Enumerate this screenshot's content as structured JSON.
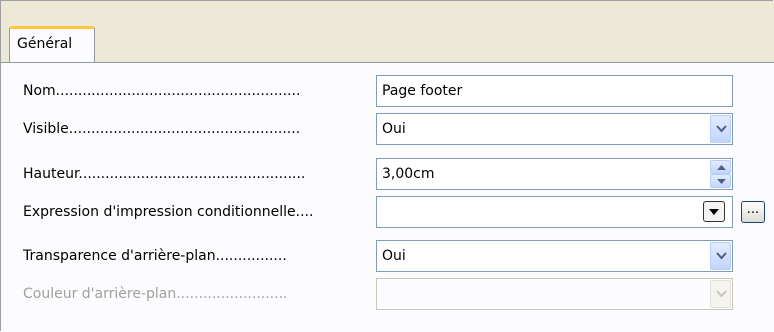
{
  "tabs": [
    {
      "label": "Général",
      "active": true
    }
  ],
  "properties": {
    "name": {
      "label": "Nom.......................................................",
      "value": "Page footer"
    },
    "visible": {
      "label": "Visible....................................................",
      "value": "Oui"
    },
    "height": {
      "label": "Hauteur...................................................",
      "value": "3,00cm"
    },
    "conditional_print": {
      "label": "Expression d'impression conditionnelle....",
      "value": "",
      "ellipsis_label": "..."
    },
    "bg_transparency": {
      "label": "Transparence d'arrière-plan................",
      "value": "Oui"
    },
    "bg_color": {
      "label": "Couleur d'arrière-plan.........................",
      "value": "",
      "disabled": true
    }
  },
  "colors": {
    "active_tab_accent": "#ffc83c",
    "field_border": "#7f9db9",
    "disabled_text": "#a0a0a0"
  },
  "icons": {
    "dropdown": "chevron-down-icon",
    "spinner": "spin-up-down-icon",
    "ellipsis": "ellipsis-icon"
  }
}
